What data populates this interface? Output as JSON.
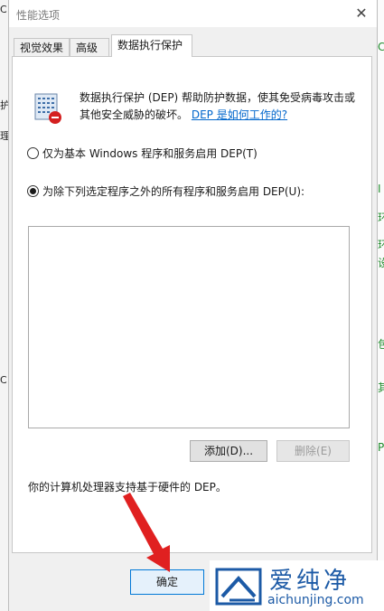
{
  "background_left": {
    "fragments": [
      "C",
      "护",
      "理",
      "C"
    ]
  },
  "background_right": {
    "fragments": [
      "C",
      "I",
      "环",
      "环",
      "设",
      "包",
      "其",
      "P"
    ]
  },
  "dialog": {
    "title": "性能选项",
    "close_glyph": "✕",
    "tabs": [
      {
        "label": "视觉效果",
        "active": false
      },
      {
        "label": "高级",
        "active": false
      },
      {
        "label": "数据执行保护",
        "active": true
      }
    ],
    "description_text": "数据执行保护 (DEP) 帮助防护数据，使其免受病毒攻击或其他安全威胁的破坏。",
    "description_link": "DEP 是如何工作的?",
    "options": [
      {
        "label": "仅为基本 Windows 程序和服务启用 DEP(T)",
        "checked": false
      },
      {
        "label": "为除下列选定程序之外的所有程序和服务启用 DEP(U):",
        "checked": true
      }
    ],
    "add_button": "添加(D)...",
    "remove_button": "删除(E)",
    "hardware_note": "你的计算机处理器支持基于硬件的 DEP。",
    "ok_button": "确定"
  },
  "watermark": {
    "chinese": "爱纯净",
    "url": "aichunjing.com",
    "color": "#1c5aa6"
  },
  "annotation": {
    "arrow_color": "#e02020"
  }
}
